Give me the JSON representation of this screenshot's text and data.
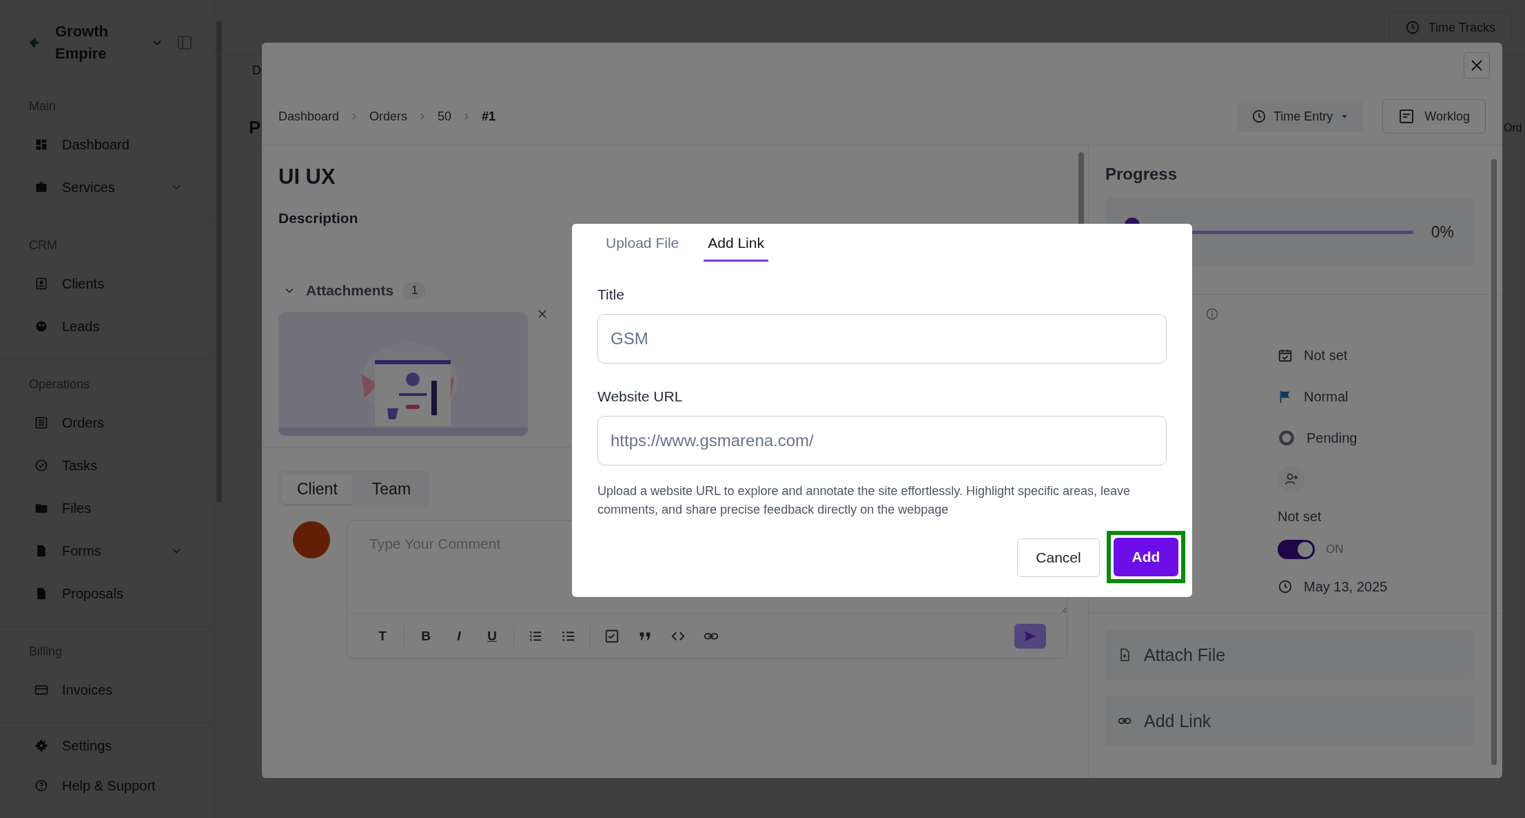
{
  "background": {
    "breadcrumb_fragment": "D",
    "heading_fragment": "P",
    "right_fragment": "Ord",
    "time_tracks_button": "Time Tracks"
  },
  "sidebar": {
    "workspace": "Growth Empire",
    "sections": [
      {
        "title": "Main",
        "items": [
          {
            "label": "Dashboard",
            "expandable": false
          },
          {
            "label": "Services",
            "expandable": true
          }
        ]
      },
      {
        "title": "CRM",
        "items": [
          {
            "label": "Clients",
            "expandable": false
          },
          {
            "label": "Leads",
            "expandable": false
          }
        ]
      },
      {
        "title": "Operations",
        "items": [
          {
            "label": "Orders",
            "expandable": false
          },
          {
            "label": "Tasks",
            "expandable": false
          },
          {
            "label": "Files",
            "expandable": false
          },
          {
            "label": "Forms",
            "expandable": true
          },
          {
            "label": "Proposals",
            "expandable": false
          }
        ]
      },
      {
        "title": "Billing",
        "items": [
          {
            "label": "Invoices",
            "expandable": false
          }
        ]
      }
    ],
    "footer_items": [
      {
        "label": "Settings"
      },
      {
        "label": "Help & Support"
      }
    ]
  },
  "modal": {
    "breadcrumb": [
      "Dashboard",
      "Orders",
      "50",
      "#1"
    ],
    "time_entry_button": "Time Entry",
    "worklog_button": "Worklog",
    "title": "UI UX",
    "description_label": "Description",
    "attachments": {
      "label": "Attachments",
      "count": "1",
      "expanded": true
    },
    "comment_tabs": [
      {
        "label": "Client",
        "selected": true
      },
      {
        "label": "Team",
        "selected": false
      }
    ],
    "comment_placeholder": "Type Your Comment",
    "format_buttons": [
      "T",
      "B",
      "I",
      "U"
    ],
    "progress": {
      "title": "Progress",
      "level": 0,
      "reading": "0%"
    },
    "details": [
      {
        "kind": "date",
        "value": "Not set"
      },
      {
        "kind": "priority",
        "value": "Normal"
      },
      {
        "kind": "status",
        "value": "Pending"
      },
      {
        "kind": "assignee"
      },
      {
        "kind": "text",
        "value": "Not set"
      },
      {
        "kind": "toggle",
        "on": true,
        "value": "ON"
      },
      {
        "kind": "time",
        "value": "May 13, 2025"
      }
    ],
    "actions": [
      {
        "label": "Attach File"
      },
      {
        "label": "Add Link"
      }
    ]
  },
  "dialog": {
    "tabs": [
      {
        "label": "Upload File",
        "selected": false
      },
      {
        "label": "Add Link",
        "selected": true
      }
    ],
    "fields": [
      {
        "label": "Title",
        "value": "GSM"
      },
      {
        "label": "Website URL",
        "value": "https://www.gsmarena.com/"
      }
    ],
    "help": "Upload a website URL to explore and annotate the site effortlessly. Highlight specific areas, leave comments, and share precise feedback directly on the webpage",
    "buttons": [
      {
        "label": "Cancel",
        "kind": "secondary",
        "highlighted": false
      },
      {
        "label": "Add",
        "kind": "primary",
        "highlighted": true
      }
    ]
  }
}
